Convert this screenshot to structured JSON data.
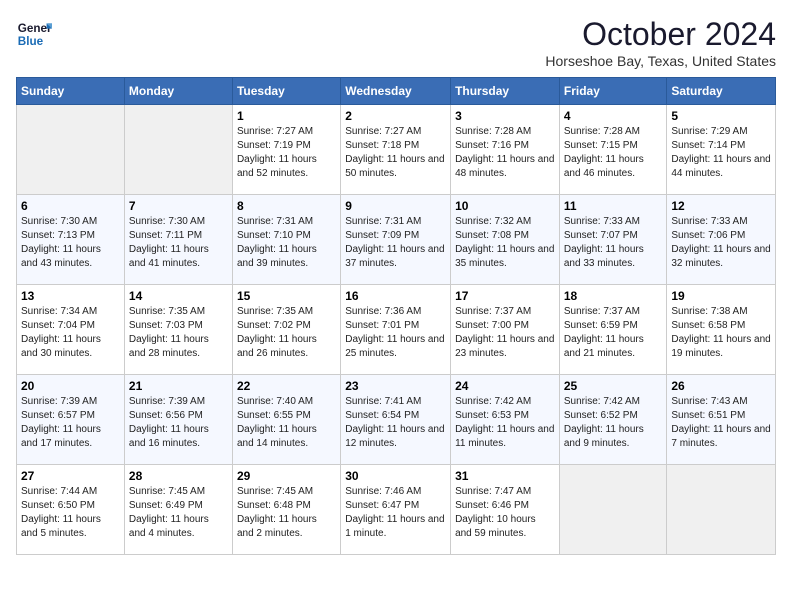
{
  "header": {
    "logo_line1": "General",
    "logo_line2": "Blue",
    "month": "October 2024",
    "location": "Horseshoe Bay, Texas, United States"
  },
  "weekdays": [
    "Sunday",
    "Monday",
    "Tuesday",
    "Wednesday",
    "Thursday",
    "Friday",
    "Saturday"
  ],
  "weeks": [
    [
      {
        "day": "",
        "empty": true
      },
      {
        "day": "",
        "empty": true
      },
      {
        "day": "1",
        "sunrise": "7:27 AM",
        "sunset": "7:19 PM",
        "daylight": "11 hours and 52 minutes."
      },
      {
        "day": "2",
        "sunrise": "7:27 AM",
        "sunset": "7:18 PM",
        "daylight": "11 hours and 50 minutes."
      },
      {
        "day": "3",
        "sunrise": "7:28 AM",
        "sunset": "7:16 PM",
        "daylight": "11 hours and 48 minutes."
      },
      {
        "day": "4",
        "sunrise": "7:28 AM",
        "sunset": "7:15 PM",
        "daylight": "11 hours and 46 minutes."
      },
      {
        "day": "5",
        "sunrise": "7:29 AM",
        "sunset": "7:14 PM",
        "daylight": "11 hours and 44 minutes."
      }
    ],
    [
      {
        "day": "6",
        "sunrise": "7:30 AM",
        "sunset": "7:13 PM",
        "daylight": "11 hours and 43 minutes."
      },
      {
        "day": "7",
        "sunrise": "7:30 AM",
        "sunset": "7:11 PM",
        "daylight": "11 hours and 41 minutes."
      },
      {
        "day": "8",
        "sunrise": "7:31 AM",
        "sunset": "7:10 PM",
        "daylight": "11 hours and 39 minutes."
      },
      {
        "day": "9",
        "sunrise": "7:31 AM",
        "sunset": "7:09 PM",
        "daylight": "11 hours and 37 minutes."
      },
      {
        "day": "10",
        "sunrise": "7:32 AM",
        "sunset": "7:08 PM",
        "daylight": "11 hours and 35 minutes."
      },
      {
        "day": "11",
        "sunrise": "7:33 AM",
        "sunset": "7:07 PM",
        "daylight": "11 hours and 33 minutes."
      },
      {
        "day": "12",
        "sunrise": "7:33 AM",
        "sunset": "7:06 PM",
        "daylight": "11 hours and 32 minutes."
      }
    ],
    [
      {
        "day": "13",
        "sunrise": "7:34 AM",
        "sunset": "7:04 PM",
        "daylight": "11 hours and 30 minutes."
      },
      {
        "day": "14",
        "sunrise": "7:35 AM",
        "sunset": "7:03 PM",
        "daylight": "11 hours and 28 minutes."
      },
      {
        "day": "15",
        "sunrise": "7:35 AM",
        "sunset": "7:02 PM",
        "daylight": "11 hours and 26 minutes."
      },
      {
        "day": "16",
        "sunrise": "7:36 AM",
        "sunset": "7:01 PM",
        "daylight": "11 hours and 25 minutes."
      },
      {
        "day": "17",
        "sunrise": "7:37 AM",
        "sunset": "7:00 PM",
        "daylight": "11 hours and 23 minutes."
      },
      {
        "day": "18",
        "sunrise": "7:37 AM",
        "sunset": "6:59 PM",
        "daylight": "11 hours and 21 minutes."
      },
      {
        "day": "19",
        "sunrise": "7:38 AM",
        "sunset": "6:58 PM",
        "daylight": "11 hours and 19 minutes."
      }
    ],
    [
      {
        "day": "20",
        "sunrise": "7:39 AM",
        "sunset": "6:57 PM",
        "daylight": "11 hours and 17 minutes."
      },
      {
        "day": "21",
        "sunrise": "7:39 AM",
        "sunset": "6:56 PM",
        "daylight": "11 hours and 16 minutes."
      },
      {
        "day": "22",
        "sunrise": "7:40 AM",
        "sunset": "6:55 PM",
        "daylight": "11 hours and 14 minutes."
      },
      {
        "day": "23",
        "sunrise": "7:41 AM",
        "sunset": "6:54 PM",
        "daylight": "11 hours and 12 minutes."
      },
      {
        "day": "24",
        "sunrise": "7:42 AM",
        "sunset": "6:53 PM",
        "daylight": "11 hours and 11 minutes."
      },
      {
        "day": "25",
        "sunrise": "7:42 AM",
        "sunset": "6:52 PM",
        "daylight": "11 hours and 9 minutes."
      },
      {
        "day": "26",
        "sunrise": "7:43 AM",
        "sunset": "6:51 PM",
        "daylight": "11 hours and 7 minutes."
      }
    ],
    [
      {
        "day": "27",
        "sunrise": "7:44 AM",
        "sunset": "6:50 PM",
        "daylight": "11 hours and 5 minutes."
      },
      {
        "day": "28",
        "sunrise": "7:45 AM",
        "sunset": "6:49 PM",
        "daylight": "11 hours and 4 minutes."
      },
      {
        "day": "29",
        "sunrise": "7:45 AM",
        "sunset": "6:48 PM",
        "daylight": "11 hours and 2 minutes."
      },
      {
        "day": "30",
        "sunrise": "7:46 AM",
        "sunset": "6:47 PM",
        "daylight": "11 hours and 1 minute."
      },
      {
        "day": "31",
        "sunrise": "7:47 AM",
        "sunset": "6:46 PM",
        "daylight": "10 hours and 59 minutes."
      },
      {
        "day": "",
        "empty": true
      },
      {
        "day": "",
        "empty": true
      }
    ]
  ],
  "labels": {
    "sunrise_prefix": "Sunrise: ",
    "sunset_prefix": "Sunset: ",
    "daylight_prefix": "Daylight: "
  }
}
